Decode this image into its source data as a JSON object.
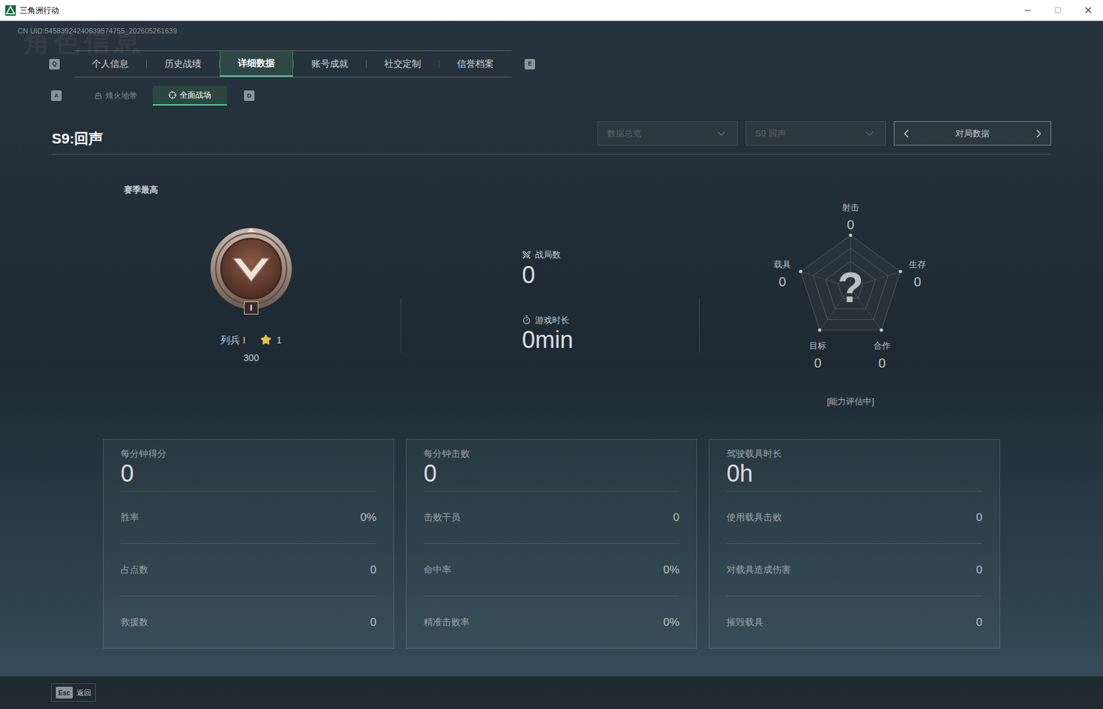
{
  "window": {
    "title": "三角洲行动"
  },
  "uid": "CN UID:54583924240639574755_202605261639",
  "watermark": "角色信息",
  "tabs": {
    "prev_key": "Q",
    "next_key": "E",
    "items": [
      {
        "label": "个人信息",
        "selected": false
      },
      {
        "label": "历史战绩",
        "selected": false
      },
      {
        "label": "详细数据",
        "selected": true
      },
      {
        "label": "账号成就",
        "selected": false
      },
      {
        "label": "社交定制",
        "selected": false
      },
      {
        "label": "信誉档案",
        "selected": false
      }
    ]
  },
  "subtabs": {
    "prev_key": "A",
    "next_key": "D",
    "items": [
      {
        "label": "烽火地带",
        "selected": false,
        "kind": "extraction"
      },
      {
        "label": "全面战场",
        "selected": true,
        "kind": "warfare"
      }
    ]
  },
  "season_title": "S9:回声",
  "filters": [
    {
      "label": "数据总览",
      "disabled": true
    },
    {
      "label": "S9 回声",
      "disabled": true
    }
  ],
  "view_switch": {
    "label": "对局数据"
  },
  "season_best": {
    "label": "赛季最高",
    "tier": "I",
    "rank": "列兵 I",
    "stars": "1",
    "score": "300"
  },
  "summary": [
    {
      "label": "战局数",
      "value": "0",
      "kind": "matches"
    },
    {
      "label": "游戏时长",
      "value": "0min",
      "kind": "time"
    }
  ],
  "radar": {
    "center": "?",
    "status": "[能力评估中]",
    "axes": [
      {
        "label": "射击",
        "value": "0"
      },
      {
        "label": "生存",
        "value": "0"
      },
      {
        "label": "合作",
        "value": "0"
      },
      {
        "label": "目标",
        "value": "0"
      },
      {
        "label": "载具",
        "value": "0"
      }
    ]
  },
  "cards": [
    {
      "title": "每分钟得分",
      "value": "0",
      "rows": [
        {
          "label": "胜率",
          "value": "0%"
        },
        {
          "label": "占点数",
          "value": "0"
        },
        {
          "label": "救援数",
          "value": "0"
        }
      ]
    },
    {
      "title": "每分钟击败",
      "value": "0",
      "rows": [
        {
          "label": "击败干员",
          "value": "0"
        },
        {
          "label": "命中率",
          "value": "0%"
        },
        {
          "label": "精准击败率",
          "value": "0%"
        }
      ]
    },
    {
      "title": "驾驶载具时长",
      "value": "0h",
      "rows": [
        {
          "label": "使用载具击败",
          "value": "0"
        },
        {
          "label": "对载具造成伤害",
          "value": "0"
        },
        {
          "label": "摧毁载具",
          "value": "0"
        }
      ]
    }
  ],
  "footer": {
    "key": "Esc",
    "label": "返回"
  }
}
